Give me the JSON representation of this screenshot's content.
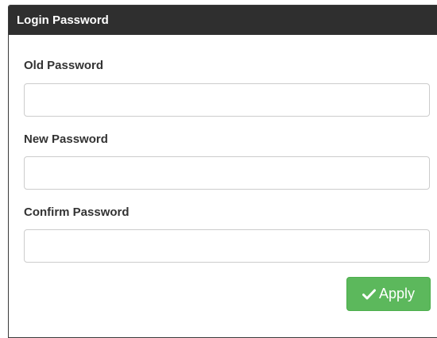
{
  "panel": {
    "title": "Login Password"
  },
  "form": {
    "old_password_label": "Old Password",
    "old_password_value": "",
    "new_password_label": "New Password",
    "new_password_value": "",
    "confirm_password_label": "Confirm Password",
    "confirm_password_value": ""
  },
  "actions": {
    "apply_label": "Apply",
    "apply_icon": "check-icon",
    "apply_color": "#5cb85c"
  },
  "colors": {
    "header_bg": "#2f2f2f",
    "header_text": "#ffffff"
  }
}
